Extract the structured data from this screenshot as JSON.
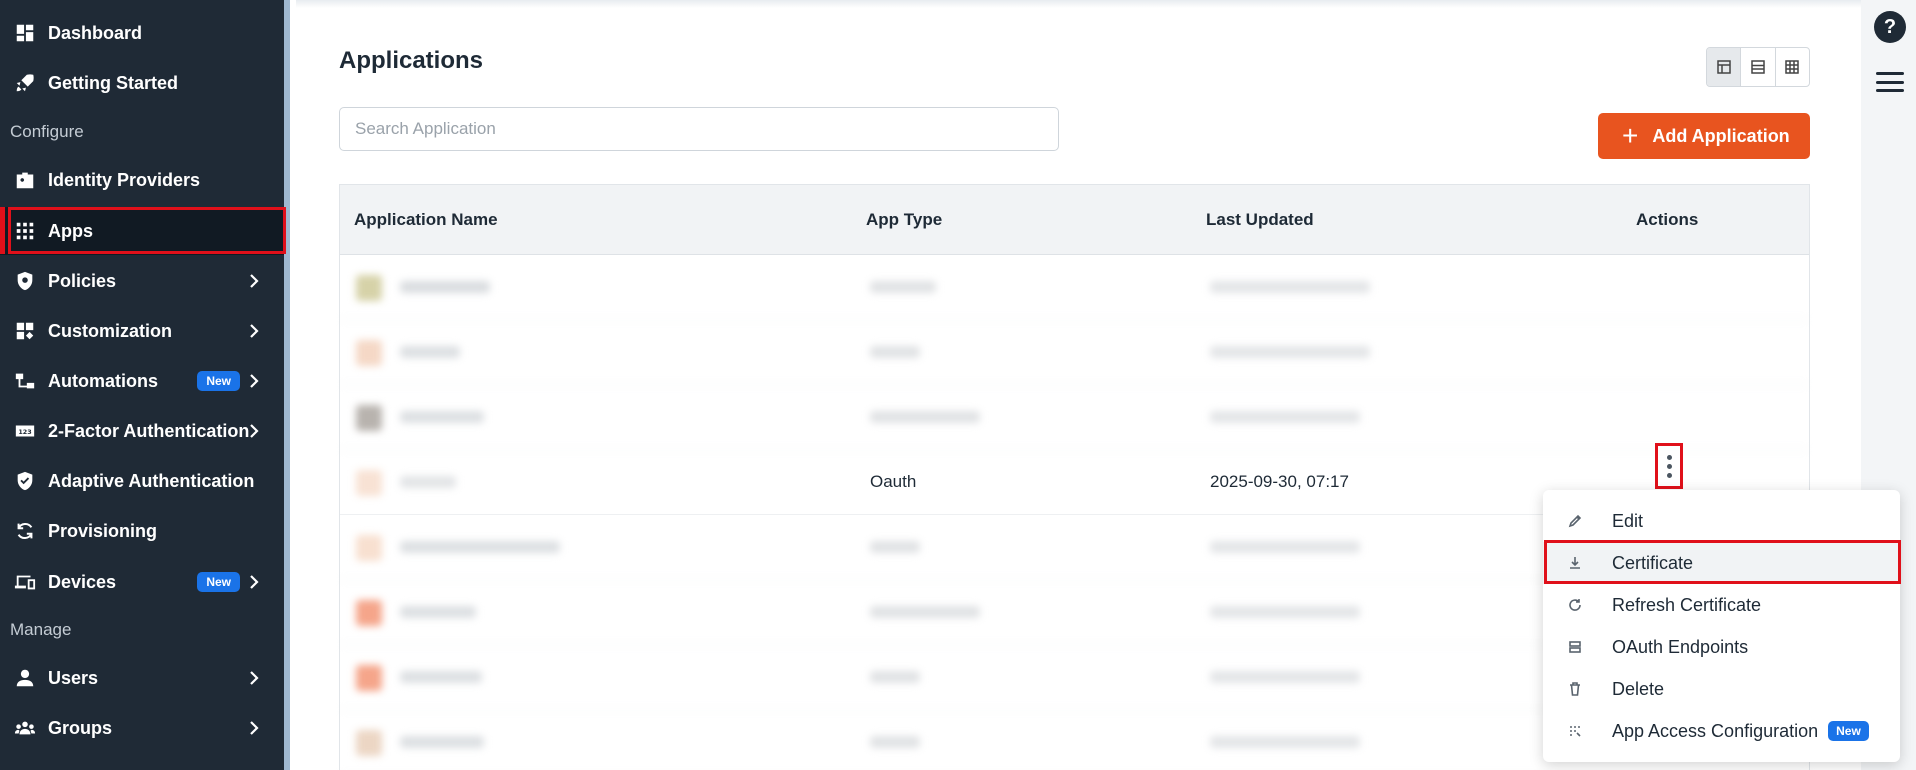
{
  "sidebar": {
    "items": [
      {
        "label": "Dashboard",
        "icon": "dashboard-icon"
      },
      {
        "label": "Getting Started",
        "icon": "rocket-icon"
      },
      {
        "label": "Identity Providers",
        "icon": "id-badge-icon"
      },
      {
        "label": "Apps",
        "icon": "apps-grid-icon"
      },
      {
        "label": "Policies",
        "icon": "policy-shield-icon"
      },
      {
        "label": "Customization",
        "icon": "customization-icon"
      },
      {
        "label": "Automations",
        "icon": "automation-icon",
        "badge": "New"
      },
      {
        "label": "2-Factor Authentication",
        "icon": "two-factor-icon"
      },
      {
        "label": "Adaptive Authentication",
        "icon": "shield-check-icon"
      },
      {
        "label": "Provisioning",
        "icon": "sync-icon"
      },
      {
        "label": "Devices",
        "icon": "devices-icon",
        "badge": "New"
      },
      {
        "label": "Users",
        "icon": "user-icon"
      },
      {
        "label": "Groups",
        "icon": "groups-icon"
      }
    ],
    "sections": {
      "configure": "Configure",
      "manage": "Manage"
    },
    "active": "Apps"
  },
  "header": {
    "title": "Applications",
    "search_placeholder": "Search Application",
    "add_label": "Add Application"
  },
  "table": {
    "columns": [
      "Application Name",
      "App Type",
      "Last Updated",
      "Actions"
    ],
    "visible_row": {
      "app_type": "Oauth",
      "last_updated": "2025-09-30, 07:17"
    }
  },
  "menu": {
    "items": [
      {
        "label": "Edit",
        "icon": "pencil-icon"
      },
      {
        "label": "Certificate",
        "icon": "download-icon"
      },
      {
        "label": "Refresh Certificate",
        "icon": "refresh-icon"
      },
      {
        "label": "OAuth Endpoints",
        "icon": "endpoints-icon"
      },
      {
        "label": "Delete",
        "icon": "trash-icon"
      },
      {
        "label": "App Access Configuration",
        "icon": "access-config-icon",
        "badge": "New"
      }
    ],
    "highlighted": "Certificate"
  },
  "colors": {
    "sidebar_bg": "#1f2a36",
    "accent": "#e8541f",
    "badge": "#1a73e8",
    "annotation_red": "#e0101a"
  },
  "rail": {
    "help_glyph": "?"
  }
}
